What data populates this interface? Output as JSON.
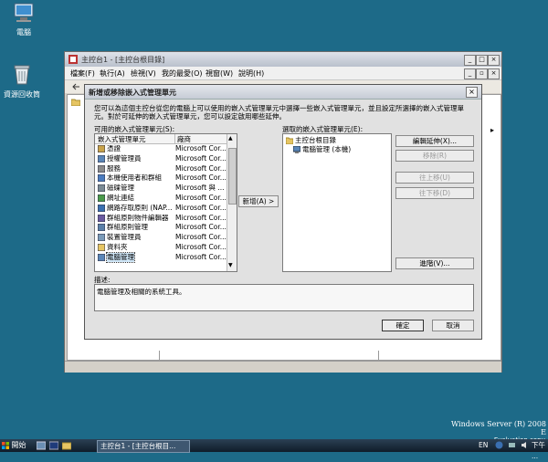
{
  "desktop": {
    "icons": [
      {
        "label": "電腦"
      },
      {
        "label": "資源回收筒"
      }
    ],
    "brand": "Windows Server (R) 2008 E",
    "brand_sub": "Evaluation copy."
  },
  "mmc": {
    "title": "主控台1 - [主控台根目錄]",
    "menu": [
      "檔案(F)",
      "執行(A)",
      "檢視(V)",
      "我的最愛(O)",
      "視窗(W)",
      "說明(H)"
    ]
  },
  "dialog": {
    "title": "新增或移除嵌入式管理單元",
    "description": "您可以為這個主控台從您的電腦上可以使用的嵌入式管理單元中選擇一些嵌入式管理單元，並且設定所選擇的嵌入式管理單元。對於可延伸的嵌入式管理單元，您可以設定啟用哪些延伸。",
    "available_label": "可用的嵌入式管理單元(S):",
    "available_columns": [
      "嵌入式管理單元",
      "廠商"
    ],
    "available_items": [
      {
        "name": "憑證",
        "vendor": "Microsoft Cor..."
      },
      {
        "name": "授權管理員",
        "vendor": "Microsoft Cor..."
      },
      {
        "name": "服務",
        "vendor": "Microsoft Cor..."
      },
      {
        "name": "本機使用者和群組",
        "vendor": "Microsoft Cor..."
      },
      {
        "name": "磁碟管理",
        "vendor": "Microsoft 與 ..."
      },
      {
        "name": "網址連結",
        "vendor": "Microsoft Cor..."
      },
      {
        "name": "網路存取原則 (NAP...",
        "vendor": "Microsoft Cor..."
      },
      {
        "name": "群組原則物件編輯器",
        "vendor": "Microsoft Cor..."
      },
      {
        "name": "群組原則管理",
        "vendor": "Microsoft Cor..."
      },
      {
        "name": "裝置管理員",
        "vendor": "Microsoft Cor..."
      },
      {
        "name": "資料夾",
        "vendor": "Microsoft Cor..."
      },
      {
        "name": "電腦管理",
        "vendor": "Microsoft Cor..."
      }
    ],
    "selected_index": 11,
    "add_button": "新增(A) >",
    "selected_label": "選取的嵌入式管理單元(E):",
    "selected_tree": [
      {
        "name": "主控台根目錄"
      },
      {
        "name": "電腦管理 (本機)"
      }
    ],
    "buttons": {
      "edit_extensions": "編輯延伸(X)...",
      "remove": "移除(R)",
      "move_up": "往上移(U)",
      "move_down": "往下移(D)",
      "advanced": "進階(V)..."
    },
    "desc_label": "描述:",
    "desc_text": "電腦管理及相關的系統工具。",
    "ok": "確定",
    "cancel": "取消"
  },
  "taskbar": {
    "start": "開始",
    "task": "主控台1 - [主控台根目...",
    "lang": "EN",
    "clock": "下午 ..."
  }
}
